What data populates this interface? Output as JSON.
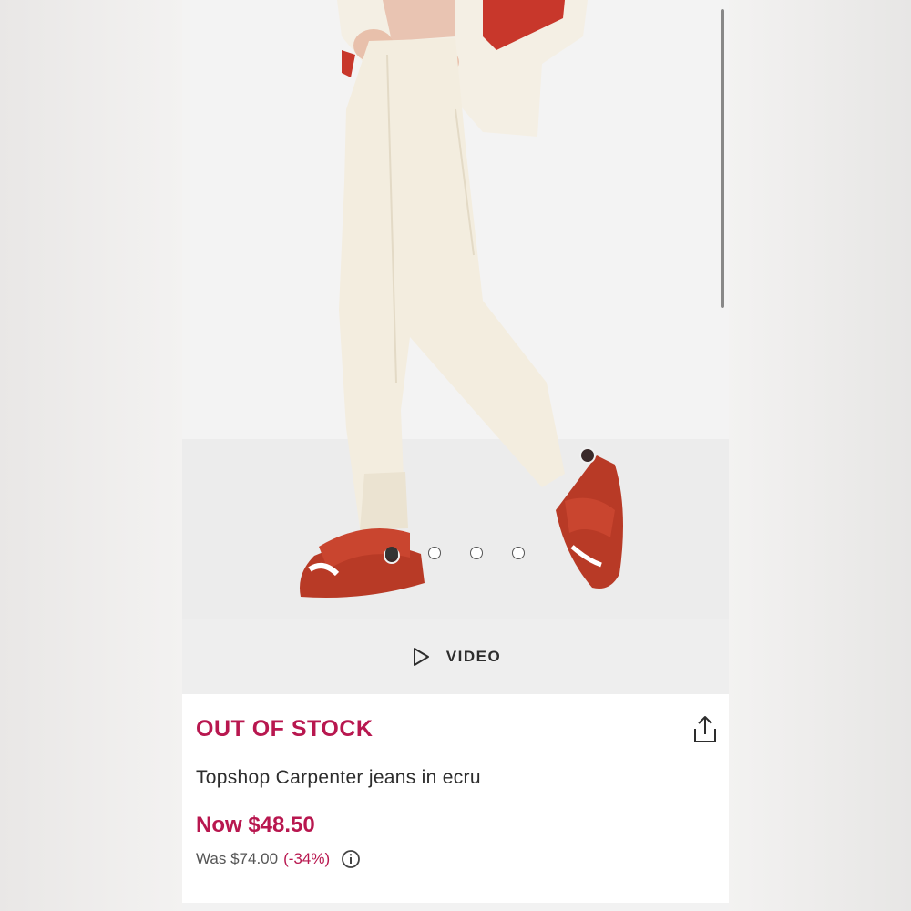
{
  "gallery": {
    "image_alt": "Model wearing ecru carpenter jeans with red sandals",
    "slide_count": 4,
    "active_slide": 1
  },
  "video": {
    "label": "VIDEO",
    "icon": "play-icon"
  },
  "product": {
    "stock_status": "OUT OF STOCK",
    "title": "Topshop Carpenter jeans in ecru",
    "price_now": "Now $48.50",
    "price_was": "Was $74.00",
    "discount": "(-34%)",
    "share_icon": "share-icon",
    "info_icon": "info-icon"
  },
  "colors": {
    "accent": "#b8174f",
    "text": "#2d2d2d",
    "muted": "#555555",
    "video_bar": "#eeeeee"
  }
}
